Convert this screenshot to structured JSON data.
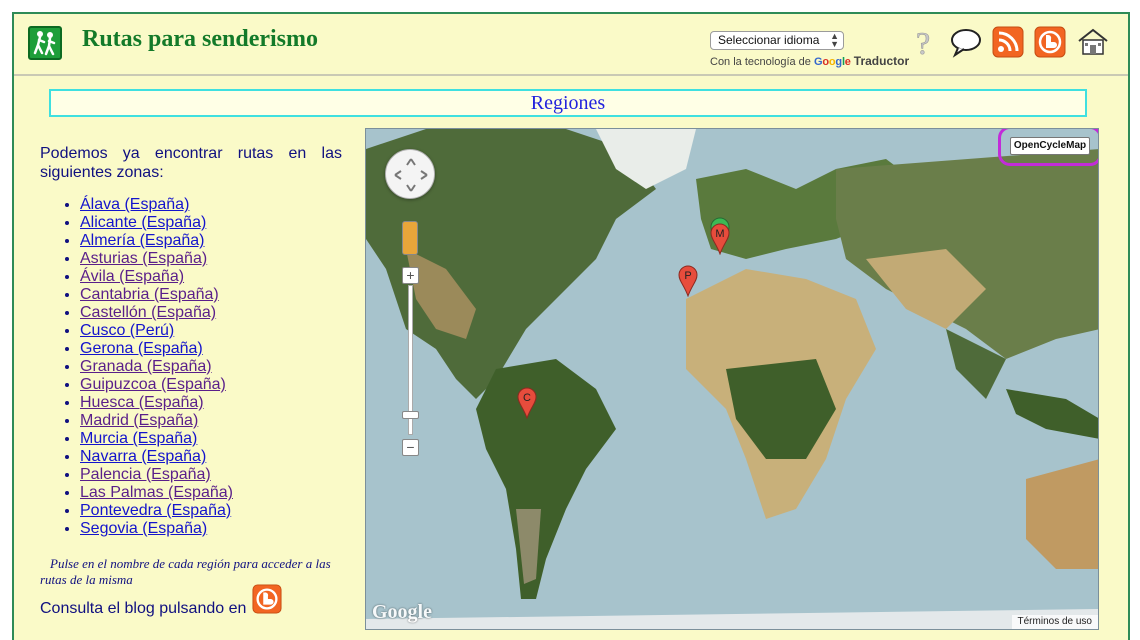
{
  "header": {
    "title": "Rutas para senderismo",
    "language_select": "Seleccionar idioma",
    "powered_prefix": "Con la tecnología de",
    "powered_google": "Google",
    "powered_translator": "Traductor",
    "icons": [
      "help-icon",
      "comment-icon",
      "rss-icon",
      "blogger-icon",
      "home-icon"
    ],
    "accent_color": "#137a29"
  },
  "section_title": "Regiones",
  "sidebar": {
    "intro": "Podemos ya encontrar rutas en las siguientes zonas:",
    "regions": [
      {
        "label": "Álava (España)",
        "visited": false
      },
      {
        "label": "Alicante (España)",
        "visited": false
      },
      {
        "label": "Almería (España)",
        "visited": false
      },
      {
        "label": "Asturias (España)",
        "visited": true
      },
      {
        "label": "Ávila (España)",
        "visited": true
      },
      {
        "label": "Cantabria (España)",
        "visited": true
      },
      {
        "label": "Castellón (España)",
        "visited": true
      },
      {
        "label": "Cusco (Perú)",
        "visited": false
      },
      {
        "label": "Gerona (España)",
        "visited": false
      },
      {
        "label": "Granada (España)",
        "visited": true
      },
      {
        "label": "Guipuzcoa (España)",
        "visited": true
      },
      {
        "label": "Huesca (España)",
        "visited": true
      },
      {
        "label": "Madrid (España)",
        "visited": true
      },
      {
        "label": "Murcia (España)",
        "visited": false
      },
      {
        "label": "Navarra (España)",
        "visited": false
      },
      {
        "label": "Palencia (España)",
        "visited": true
      },
      {
        "label": "Las Palmas (España)",
        "visited": true
      },
      {
        "label": "Pontevedra (España)",
        "visited": false
      },
      {
        "label": "Segovia (España)",
        "visited": false
      }
    ],
    "note": "Pulse en el nombre de cada región para acceder a las rutas de la misma",
    "blog_text": "Consulta el blog pulsando en"
  },
  "map": {
    "layer_button": "OpenCycleMap",
    "logo": "Google",
    "terms": "Términos de uso",
    "zoom_in": "+",
    "zoom_out": "−",
    "markers": [
      {
        "label": "M",
        "color": "#e74c3c"
      },
      {
        "label": "P",
        "color": "#e74c3c"
      },
      {
        "label": "C",
        "color": "#e74c3c"
      }
    ]
  }
}
